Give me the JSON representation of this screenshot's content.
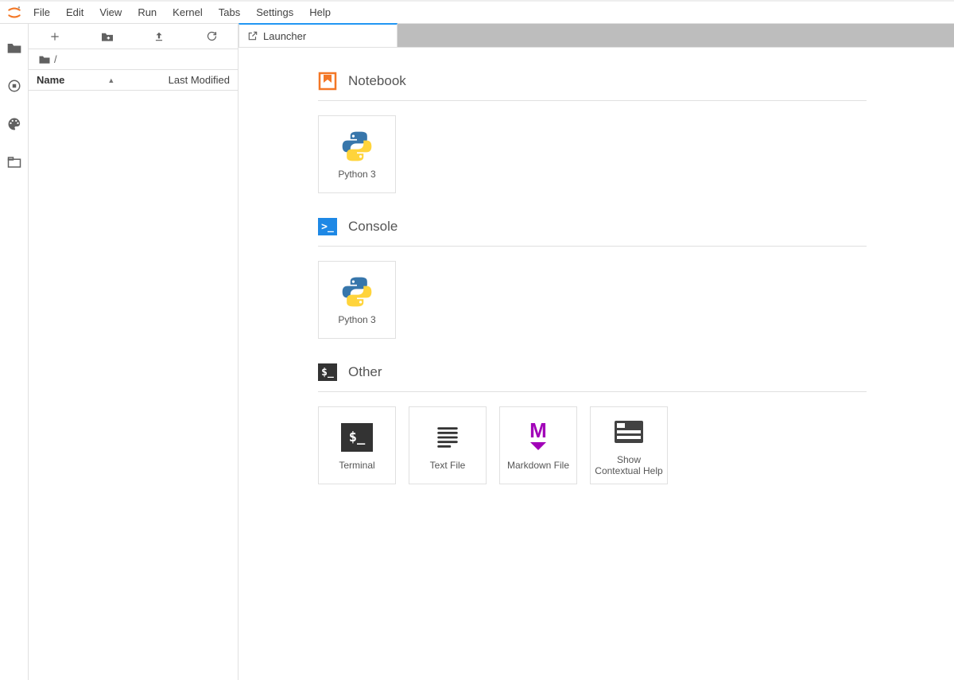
{
  "menu": {
    "items": [
      "File",
      "Edit",
      "View",
      "Run",
      "Kernel",
      "Tabs",
      "Settings",
      "Help"
    ]
  },
  "filebrowser": {
    "breadcrumb_root": "/",
    "header_name": "Name",
    "header_modified": "Last Modified"
  },
  "tab": {
    "title": "Launcher"
  },
  "launcher": {
    "sections": [
      {
        "title": "Notebook",
        "kind": "notebook",
        "cards": [
          {
            "label": "Python 3",
            "icon": "python"
          }
        ]
      },
      {
        "title": "Console",
        "kind": "console",
        "cards": [
          {
            "label": "Python 3",
            "icon": "python"
          }
        ]
      },
      {
        "title": "Other",
        "kind": "other",
        "cards": [
          {
            "label": "Terminal",
            "icon": "terminal"
          },
          {
            "label": "Text File",
            "icon": "textfile"
          },
          {
            "label": "Markdown File",
            "icon": "markdown"
          },
          {
            "label": "Show Contextual Help",
            "icon": "contexthelp"
          }
        ]
      }
    ]
  }
}
